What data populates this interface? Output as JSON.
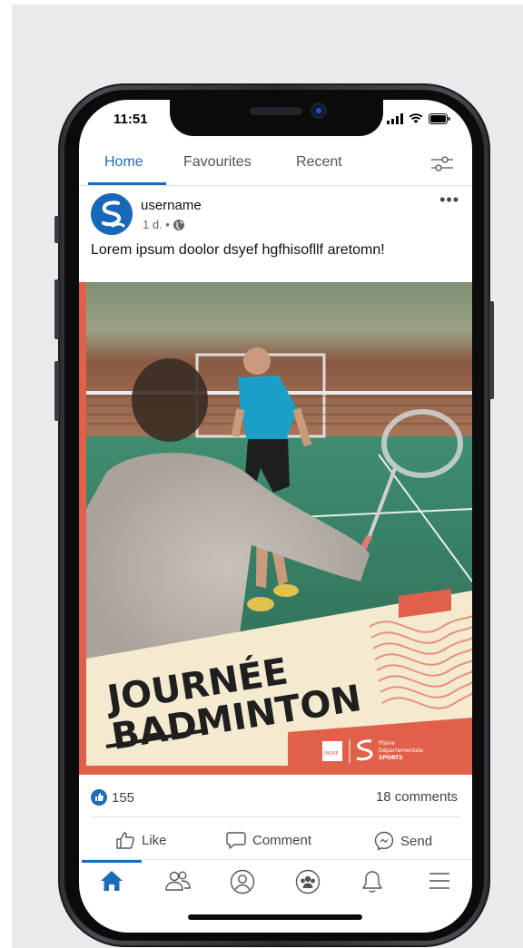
{
  "status_bar": {
    "time": "11:51"
  },
  "tabs": [
    {
      "label": "Home",
      "active": true
    },
    {
      "label": "Favourites",
      "active": false
    },
    {
      "label": "Recent",
      "active": false
    }
  ],
  "post": {
    "username": "username",
    "time_ago": "1 d. •",
    "text": "Lorem ipsum doolor dsyef hgfhisofllf aretomn!",
    "image": {
      "title_line1": "JOURNÉE",
      "title_line2": "BADMINTON",
      "logo_left": "INDRE",
      "logo_right_line1": "Plaine",
      "logo_right_line2": "Départementale",
      "logo_right_line3": "SPORTS"
    },
    "likes": "155",
    "comments": "18 comments"
  },
  "actions": {
    "like": "Like",
    "comment": "Comment",
    "send": "Send"
  },
  "colors": {
    "accent": "#1c6cb8",
    "poster_orange": "#e0604a",
    "poster_cream": "#f3ead0"
  },
  "icons": [
    "filter-icon",
    "more-icon",
    "globe-icon",
    "like-icon",
    "comment-icon",
    "messenger-icon",
    "home-icon",
    "friends-icon",
    "profile-icon",
    "groups-icon",
    "bell-icon",
    "menu-icon"
  ]
}
